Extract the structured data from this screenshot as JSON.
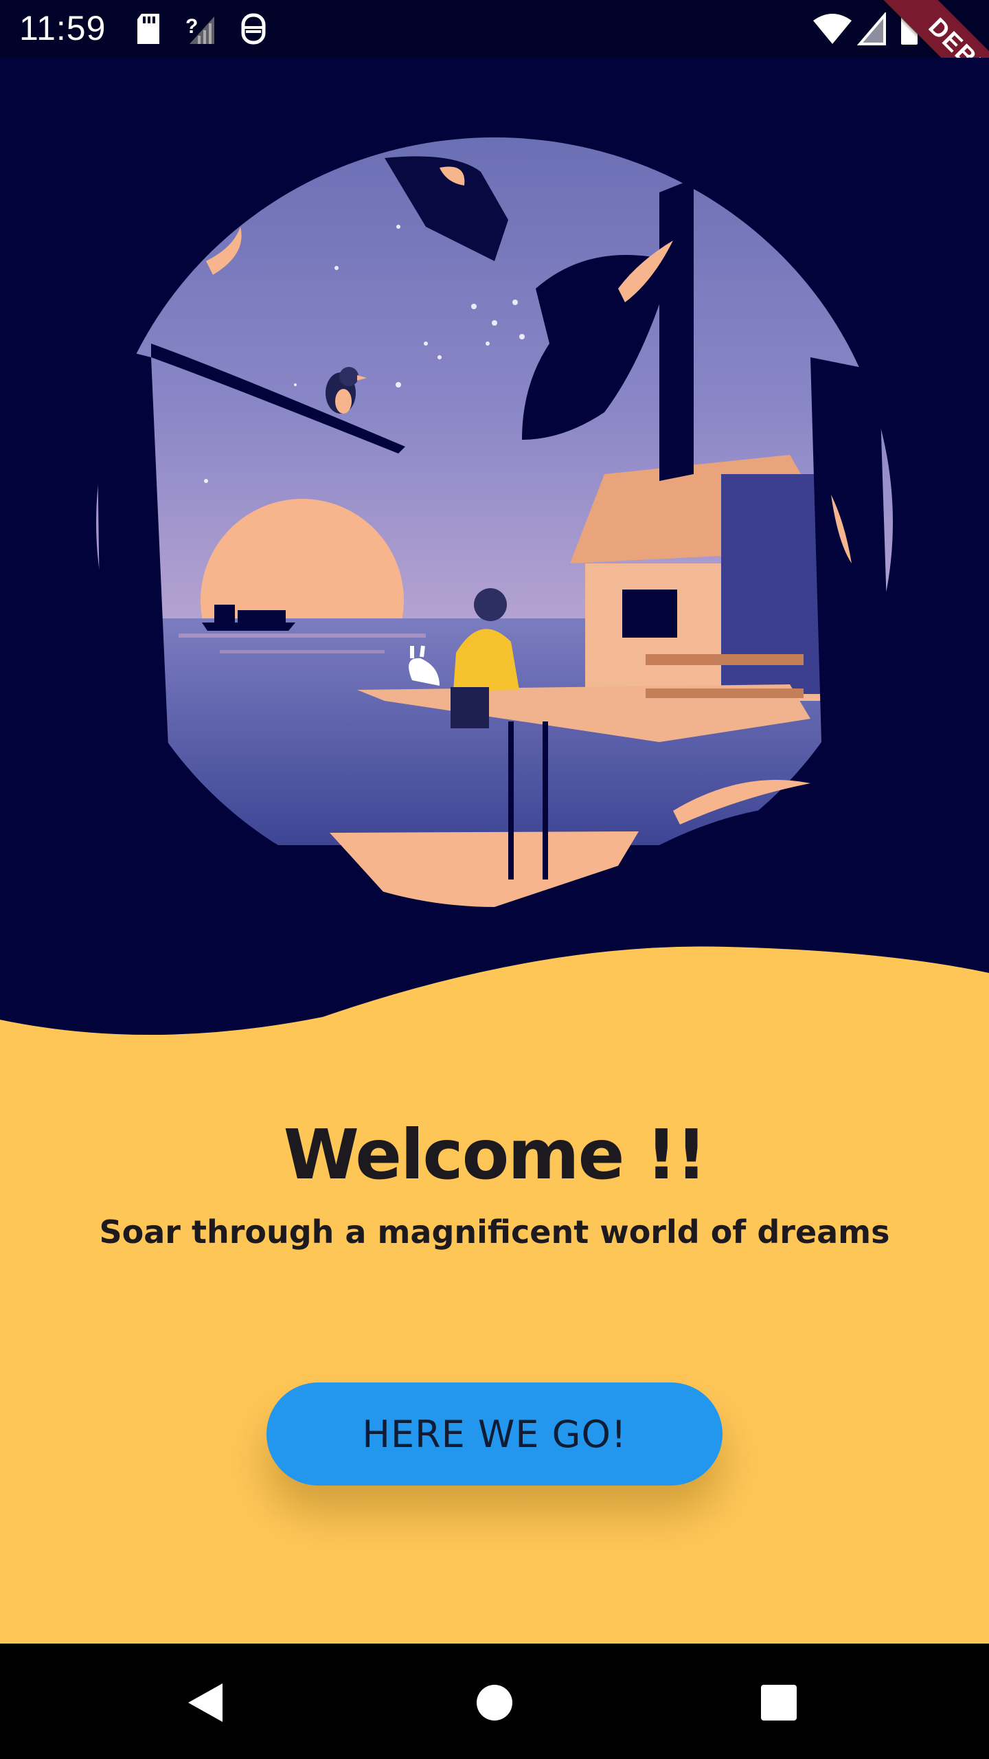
{
  "status_bar": {
    "time": "11:59",
    "icons": [
      "sd-card-icon",
      "no-sim-signal-icon",
      "sync-icon",
      "wifi-icon",
      "cell-signal-icon",
      "battery-icon"
    ],
    "debug_ribbon": "DEBUG"
  },
  "welcome": {
    "title": "Welcome !!",
    "subtitle": "Soar through a magnificent world of dreams",
    "button_label": "HERE WE GO!"
  },
  "nav_bar": {
    "buttons": [
      "back-icon",
      "home-icon",
      "recents-icon"
    ]
  },
  "colors": {
    "night_sky": "#02033a",
    "panel_yellow": "#fec657",
    "button_blue": "#2397ed",
    "text_dark": "#1d1a1f",
    "sun_peach": "#f6b58c"
  }
}
